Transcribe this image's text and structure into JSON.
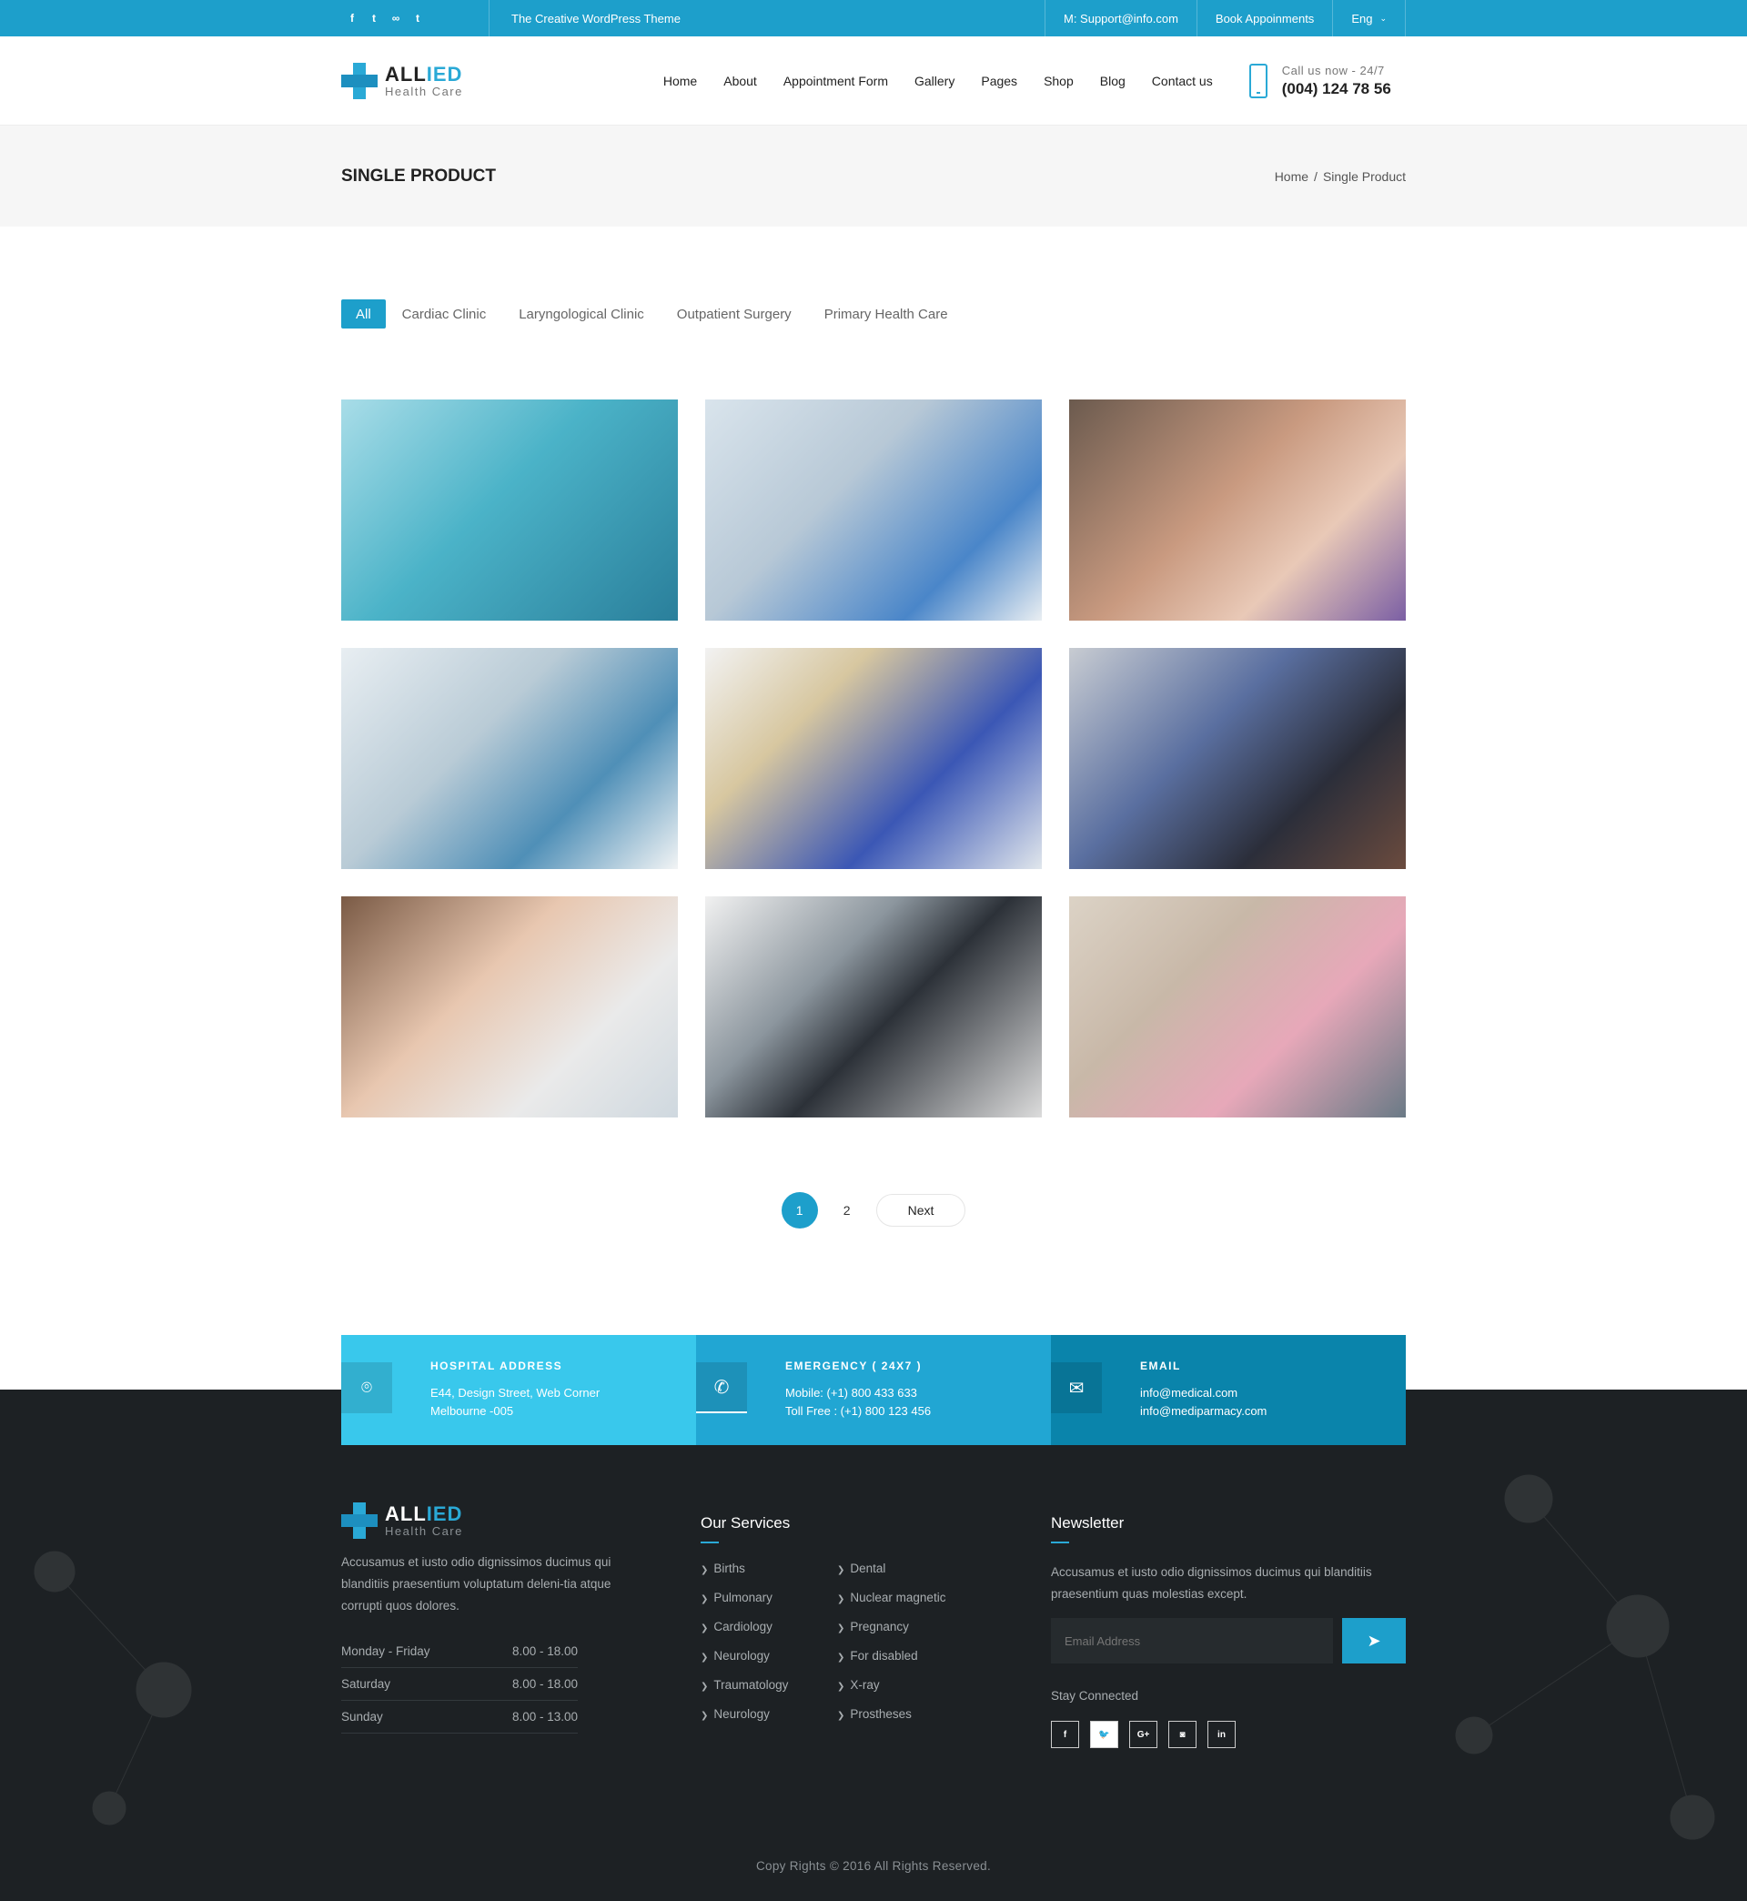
{
  "topbar": {
    "social_icons": [
      "facebook-icon",
      "twitter-icon",
      "flickr-icon",
      "tumblr-icon"
    ],
    "social_glyphs": [
      "f",
      "t",
      "∞",
      "t"
    ],
    "tagline": "The Creative WordPress Theme",
    "email": "M: Support@info.com",
    "book": "Book Appoinments",
    "lang": "Eng"
  },
  "header": {
    "logo_name_a": "ALL",
    "logo_name_b": "IED",
    "logo_sub": "Health Care",
    "nav": [
      "Home",
      "About",
      "Appointment Form",
      "Gallery",
      "Pages",
      "Shop",
      "Blog",
      "Contact us"
    ],
    "phone_label": "Call us now - 24/7",
    "phone_number": "(004) 124 78 56"
  },
  "titlebar": {
    "title": "SINGLE PRODUCT",
    "crumb_home": "Home",
    "crumb_sep": "/",
    "crumb_current": "Single Product"
  },
  "filters": [
    "All",
    "Cardiac Clinic",
    "Laryngological Clinic",
    "Outpatient Surgery",
    "Primary Health Care"
  ],
  "gallery": [
    {
      "name": "hospital-corridor-photo",
      "bg": "linear-gradient(135deg,#a9dde8,#4bb3c8 45%,#2a7f9b)"
    },
    {
      "name": "dentist-with-model-photo",
      "bg": "linear-gradient(135deg,#d9e4ec,#b7c8d6 40%,#4a86c9 75%,#e9eef2)"
    },
    {
      "name": "smiling-patient-photo",
      "bg": "linear-gradient(135deg,#6b5a4e,#c99a80 45%,#e9c9b7 70%,#7b5fa4)"
    },
    {
      "name": "doctors-xray-photo",
      "bg": "linear-gradient(135deg,#e8eef2,#b9cbd6 40%,#4f8fb7 70%,#f2f4f5)"
    },
    {
      "name": "dental-checkup-photo",
      "bg": "linear-gradient(135deg,#f2f2f2,#d7c7a0 30%,#3b57b5 65%,#e0e6ec)"
    },
    {
      "name": "dentist-xray-tablet-photo",
      "bg": "linear-gradient(135deg,#c8ccd2,#5a6fa0 40%,#2b2e3a 70%,#6b4b3e)"
    },
    {
      "name": "pediatric-exam-photo",
      "bg": "linear-gradient(135deg,#7a5a45,#e8c7b0 40%,#eaeaea 70%,#cfd8df)"
    },
    {
      "name": "brain-scan-tablet-photo",
      "bg": "linear-gradient(135deg,#f1f1f1,#8c969e 35%,#2c3138 55%,#dcdcdc)"
    },
    {
      "name": "family-consultation-photo",
      "bg": "linear-gradient(135deg,#dcd3c6,#c8b8a8 35%,#e7a8b9 65%,#6a7a86)"
    }
  ],
  "pager": {
    "pages": [
      "1",
      "2"
    ],
    "next": "Next"
  },
  "info": [
    {
      "icon": "map-pin-icon",
      "glyph": "⌾",
      "head": "HOSPITAL ADDRESS",
      "lines": [
        "E44, Design Street, Web Corner",
        "Melbourne -005"
      ]
    },
    {
      "icon": "phone-icon",
      "glyph": "✆",
      "head": "EMERGENCY ( 24X7 )",
      "lines": [
        "Mobile: (+1) 800 433 633",
        "Toll Free : (+1) 800 123 456"
      ]
    },
    {
      "icon": "envelope-icon",
      "glyph": "✉",
      "head": "EMAIL",
      "lines": [
        "info@medical.com",
        "info@mediparmacy.com"
      ]
    }
  ],
  "footer": {
    "desc": "Accusamus et iusto odio dignissimos ducimus qui blanditiis praesentium voluptatum deleni-tia atque corrupti quos dolores.",
    "hours": [
      {
        "day": "Monday - Friday",
        "time": "8.00 - 18.00"
      },
      {
        "day": "Saturday",
        "time": "8.00 - 18.00"
      },
      {
        "day": "Sunday",
        "time": "8.00 - 13.00"
      }
    ],
    "services_title": "Our Services",
    "services": [
      "Births",
      "Dental",
      "Pulmonary",
      "Nuclear magnetic",
      "Cardiology",
      "Pregnancy",
      "Neurology",
      "For disabled",
      "Traumatology",
      "X-ray",
      "Neurology",
      "Prostheses"
    ],
    "newsletter_title": "Newsletter",
    "newsletter_desc": "Accusamus et iusto odio dignissimos ducimus qui blanditiis praesentium quas molestias except.",
    "email_placeholder": "Email Address",
    "stay": "Stay Connected",
    "social": [
      {
        "icon": "facebook-icon",
        "glyph": "f"
      },
      {
        "icon": "twitter-icon",
        "glyph": "🐦"
      },
      {
        "icon": "google-plus-icon",
        "glyph": "G+"
      },
      {
        "icon": "instagram-icon",
        "glyph": "◙"
      },
      {
        "icon": "linkedin-icon",
        "glyph": "in"
      }
    ],
    "copyright": "Copy Rights © 2016 All Rights Reserved."
  },
  "colors": {
    "accent": "#1d9fcb",
    "footer_bg": "#1d2124"
  }
}
